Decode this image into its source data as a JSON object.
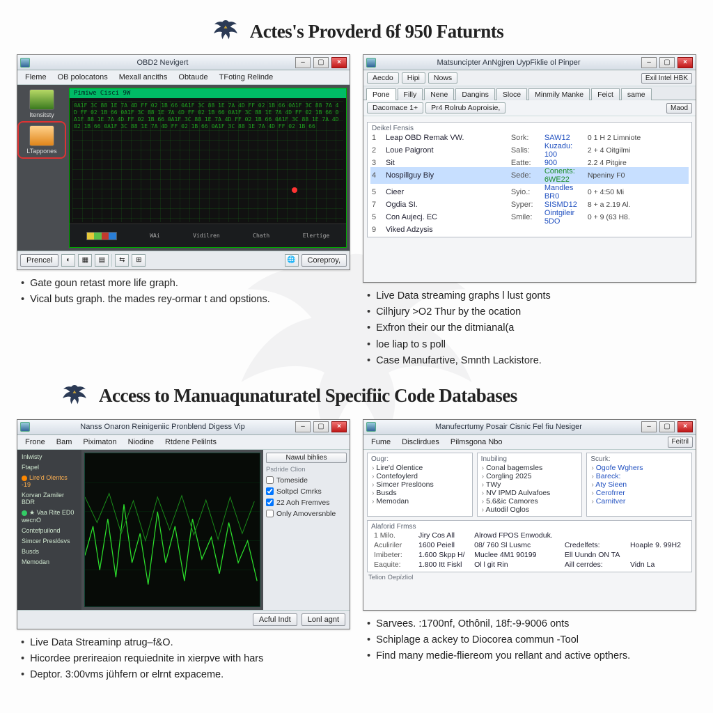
{
  "heading1": "Actes's Provderd 6f 950 Faturnts",
  "heading2": "Access to Manuaqunaturatel Specifiic Code Databases",
  "winA": {
    "title": "OBD2 Nevigert",
    "menus": [
      "Fleme",
      "OB polocatons",
      "Mexall anciths",
      "Obtaude",
      "TFoting Relinde"
    ],
    "side": [
      {
        "label": "Itensitsty"
      },
      {
        "label": "LTappones"
      }
    ],
    "main_header": "Pimiwe Cisci 9W",
    "footer_labels": [
      "WAi",
      "Vidilren",
      "Chath",
      "Elertige"
    ],
    "bottom_left": "Prencel",
    "bottom_right": "Coreproy,"
  },
  "bulletsA": [
    "Gate goun retast more life graph.",
    "Vical buts graph. the mades rey-ormar t and opstions."
  ],
  "winB": {
    "title": "Matsuncipter AnNgjren UypFiklie ol Pinper",
    "top_pills": [
      "Aecdo",
      "Hipi",
      "Nows"
    ],
    "top_right": "Exil Intel HBK",
    "tabs": [
      "Pone",
      "Filly",
      "Nene",
      "Dangins",
      "Sloce",
      "Minmily Manke",
      "Feict",
      "same"
    ],
    "toolbar_left": [
      "Dacomace 1+",
      "Pr4 Rolrub Aoproisie,"
    ],
    "toolbar_right": "Maod",
    "group_title": "Deikel Fensis",
    "rows": [
      {
        "n": "1",
        "lab": "Leap OBD Remak VW.",
        "k": "Sork:",
        "v": "SAW12",
        "ext": "0 1 H 2 Limniote"
      },
      {
        "n": "2",
        "lab": "Loue Paigront",
        "k": "Salis:",
        "v": "Kuzadu: 100",
        "ext": "2 + 4 Oitgilmi"
      },
      {
        "n": "3",
        "lab": "Sit",
        "k": "Eatte:",
        "v": "900",
        "ext": "2.2 4 Pitgire"
      },
      {
        "n": "4",
        "lab": "Nospillguy Biy",
        "k": "Sede:",
        "v": "Conents: 6WE22",
        "ext": "Npeniny F0",
        "sel": true,
        "green": true
      },
      {
        "n": "5",
        "lab": "Cieer",
        "k": "Syio.:",
        "v": "Mandles BR0",
        "ext": "0 + 4:50 Mi"
      },
      {
        "n": "7",
        "lab": "Ogdia SI.",
        "k": "Syper:",
        "v": "SISMD12",
        "ext": "8 + a 2.19 Al."
      },
      {
        "n": "5",
        "lab": "Con Aujecj. EC",
        "k": "Smile:",
        "v": "Ointgileir 5DO",
        "ext": "0 + 9 (63 H8."
      },
      {
        "n": "9",
        "lab": "Viked Adzysis",
        "k": "",
        "v": "",
        "ext": ""
      }
    ]
  },
  "bulletsB": [
    "Live Data streaming graphs l lust gonts",
    "Cilhjury >O2 Thur by the ocation",
    "Exfron their our the ditmianal(a",
    "loe liap to s poll",
    "Case Manufartive, Smnth Lackistore."
  ],
  "winC": {
    "title": "Nanss Onaron Reinigeniic Pronblend Digess Vip",
    "menus": [
      "Frone",
      "Bam",
      "Piximaton",
      "Niodine",
      "Rtdene Pelilnts"
    ],
    "side_rows": [
      "Inlwisty",
      "Ftapel",
      "Lire'd Olentcs   -19",
      "Korvan Zamiler BDR",
      "★ Vaa Rite ED0 wecnO",
      "Contefpuilond",
      "Simcer Preslösvs",
      "Busds",
      "Memodan"
    ],
    "right_label": "Nawul bihlies",
    "right_sub": "Psdride Clion",
    "checks": [
      {
        "label": "Tomeside",
        "checked": false
      },
      {
        "label": "Soltpcl Cmrks",
        "checked": true
      },
      {
        "label": "22 Aoh Fremves",
        "checked": true
      },
      {
        "label": "Only Amoversnble",
        "checked": false
      }
    ],
    "btn_left": "Acful Indt",
    "btn_right": "Lonl agnt"
  },
  "bulletsC": [
    "Live Data Streaminp atrug–f&O.",
    "Hicordee prerireaion requiednite in xierpve with hars",
    "Deptor. 3:00vms jühfern or elrnt expaceme."
  ],
  "winD": {
    "title": "Manufecrtumy Posair Cisnic Fel fiu Nesiger",
    "menus": [
      "Fume",
      "Disclirdues",
      "Pilmsgona Nbo"
    ],
    "menu_right": "Feitril",
    "cols": [
      {
        "hdr": "Ougr:",
        "items": [
          "Lire'd Olentice",
          "Contefoylerd",
          "Simcer Preslöons",
          "Busds",
          "Memodan"
        ]
      },
      {
        "hdr": "Inubiling",
        "items": [
          "Conal bagemsles",
          "Corgling 2025",
          "TWy",
          "NV IPMD Aulvafoes",
          "5.6&ic Camores",
          "Autodil Oglos"
        ]
      },
      {
        "hdr": "Scurk:",
        "items": [
          "Ogofe Wghers",
          "Bareck:",
          "Aty Sieen",
          "Cerofrrer",
          "Carnitver"
        ],
        "link": true
      }
    ],
    "frame_title": "Alaforid Frmss",
    "frame_rows": [
      [
        "1  Milo.",
        "Jiry Cos All",
        "Alrowd FPOS Enwoduk.",
        "",
        ""
      ],
      [
        "Aculiriler",
        "1600 Peiell",
        "08/ 760 Sl Lusmc",
        "Credelfets:",
        "Hoaple 9. 99H2"
      ],
      [
        "Imibeter:",
        "1.600 Skpp H/",
        "Muclee 4M1 90199",
        "Ell Uundn ON TA",
        ""
      ],
      [
        "Eaquite:",
        "1.800 Itt Fiskl",
        "Ol l git Rin",
        "Aill cerrdes:",
        "Vidn La"
      ]
    ],
    "sub": "Telion Oepïzliol"
  },
  "bulletsD": [
    "Sarvees. :1700nf, Othônil, 18f:-9-9006 onts",
    "Schiplage a ackey to Diocorea commun -Tool",
    "Find many medie-fliereom you rellant and active opthers."
  ]
}
